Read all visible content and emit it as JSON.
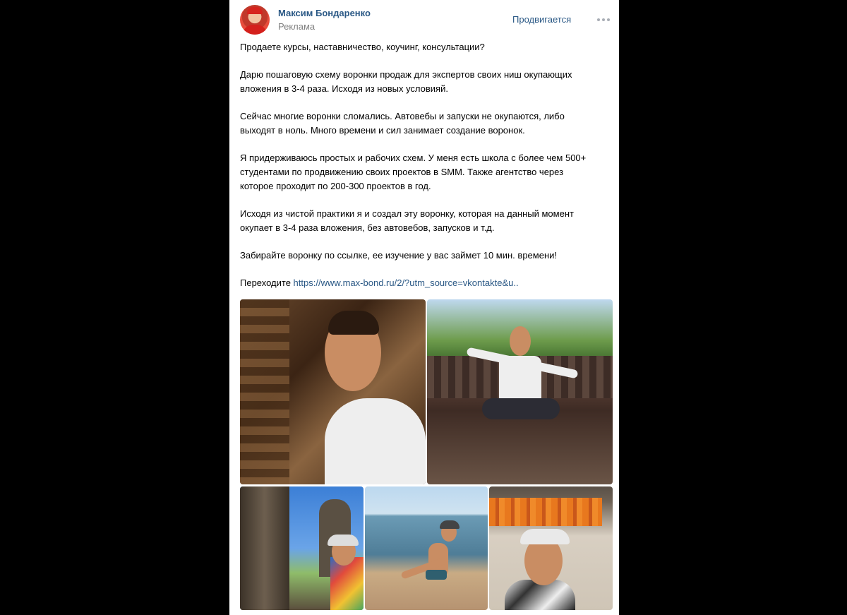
{
  "post": {
    "author": "Максим Бондаренко",
    "ad_label": "Реклама",
    "promoted_label": "Продвигается",
    "paragraphs": [
      "Продаете курсы, наставничество, коучинг, консультации?",
      "Дарю пошаговую схему воронки продаж для экспертов своих ниш окупающих\nвложения в 3-4 раза. Исходя из новых условияй.",
      "Сейчас многие воронки сломались. Автовебы и запуски не окупаются, либо\nвыходят в ноль. Много времени и сил занимает создание воронок.",
      "Я придерживаюсь простых и рабочих схем. У меня есть школа с более чем 500+\nстудентами по продвижению своих проектов в SMM. Также агентство через\nкоторое проходит по 200-300 проектов в год.",
      "Исходя из чистой практики я и создал эту воронку, которая на данный момент\nокупает в 3-4 раза вложения, без автовебов, запусков и т.д.",
      "Забирайте воронку по ссылке, ее изучение у вас займет 10 мин. времени!"
    ],
    "link_prefix": "Переходите ",
    "link_text": "https://www.max-bond.ru/2/?utm_source=vkontakte&u.."
  },
  "icons": {
    "more": "more-dots-icon"
  },
  "colors": {
    "link": "#2a5885",
    "secondary_text": "#828282",
    "background": "#000000",
    "card": "#ffffff"
  }
}
